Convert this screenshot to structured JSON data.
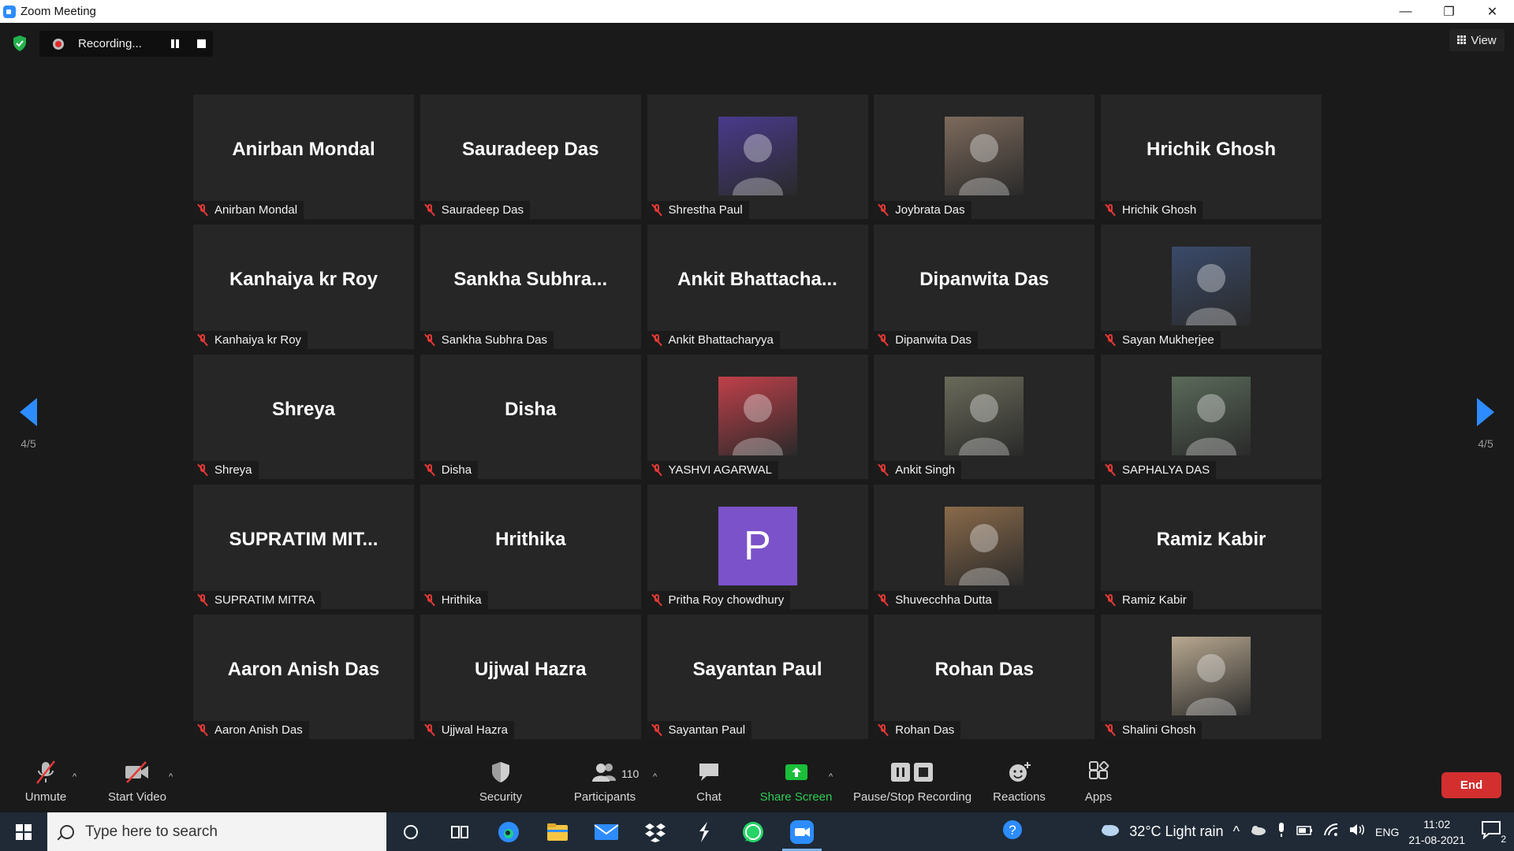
{
  "window": {
    "title": "Zoom Meeting"
  },
  "recording": {
    "status": "Recording..."
  },
  "view_label": "View",
  "pagination": {
    "left": "4/5",
    "right": "4/5"
  },
  "participants": [
    {
      "display": "Anirban Mondal",
      "label": "Anirban Mondal",
      "avatar": "none"
    },
    {
      "display": "Sauradeep Das",
      "label": "Sauradeep Das",
      "avatar": "none"
    },
    {
      "display": "",
      "label": "Shrestha Paul",
      "avatar": "photo",
      "color": "#4a3a8c"
    },
    {
      "display": "",
      "label": "Joybrata Das",
      "avatar": "photo",
      "color": "#7d6a5c"
    },
    {
      "display": "Hrichik Ghosh",
      "label": "Hrichik Ghosh",
      "avatar": "none"
    },
    {
      "display": "Kanhaiya kr Roy",
      "label": "Kanhaiya kr Roy",
      "avatar": "none"
    },
    {
      "display": "Sankha Subhra...",
      "label": "Sankha Subhra Das",
      "avatar": "none"
    },
    {
      "display": "Ankit Bhattacha...",
      "label": "Ankit Bhattacharyya",
      "avatar": "none"
    },
    {
      "display": "Dipanwita Das",
      "label": "Dipanwita Das",
      "avatar": "none"
    },
    {
      "display": "",
      "label": "Sayan Mukherjee",
      "avatar": "photo",
      "color": "#3a4a6a"
    },
    {
      "display": "Shreya",
      "label": "Shreya",
      "avatar": "none"
    },
    {
      "display": "Disha",
      "label": "Disha",
      "avatar": "none"
    },
    {
      "display": "",
      "label": "YASHVI AGARWAL",
      "avatar": "photo",
      "color": "#c0404a"
    },
    {
      "display": "",
      "label": "Ankit Singh",
      "avatar": "photo",
      "color": "#6a6a5a"
    },
    {
      "display": "",
      "label": "SAPHALYA DAS",
      "avatar": "photo",
      "color": "#5a6a5a"
    },
    {
      "display": "SUPRATIM MIT...",
      "label": "SUPRATIM MITRA",
      "avatar": "none"
    },
    {
      "display": "Hrithika",
      "label": "Hrithika",
      "avatar": "none"
    },
    {
      "display": "P",
      "label": "Pritha Roy chowdhury",
      "avatar": "letter",
      "color": "#7b52c9"
    },
    {
      "display": "",
      "label": "Shuvecchha Dutta",
      "avatar": "photo",
      "color": "#8a6a4a"
    },
    {
      "display": "Ramiz Kabir",
      "label": "Ramiz Kabir",
      "avatar": "none"
    },
    {
      "display": "Aaron Anish Das",
      "label": "Aaron Anish Das",
      "avatar": "none"
    },
    {
      "display": "Ujjwal Hazra",
      "label": "Ujjwal Hazra",
      "avatar": "none"
    },
    {
      "display": "Sayantan Paul",
      "label": "Sayantan Paul",
      "avatar": "none"
    },
    {
      "display": "Rohan Das",
      "label": "Rohan Das",
      "avatar": "none"
    },
    {
      "display": "",
      "label": "Shalini Ghosh",
      "avatar": "photo",
      "color": "#b8a890"
    }
  ],
  "toolbar": {
    "unmute": "Unmute",
    "start_video": "Start Video",
    "security": "Security",
    "participants": "Participants",
    "participant_count": "110",
    "chat": "Chat",
    "share_screen": "Share Screen",
    "pause_stop_recording": "Pause/Stop Recording",
    "reactions": "Reactions",
    "apps": "Apps",
    "end": "End"
  },
  "taskbar": {
    "search_placeholder": "Type here to search",
    "weather": "32°C  Light rain",
    "language": "ENG",
    "time": "11:02",
    "date": "21-08-2021",
    "notification_count": "2"
  },
  "colors": {
    "accent": "#2d8cff",
    "muted": "#e53935",
    "end": "#d32f2f",
    "share": "#1bbf3a"
  }
}
